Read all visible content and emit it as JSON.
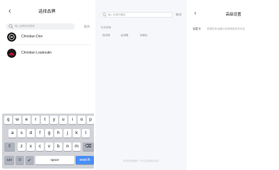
{
  "panel1": {
    "back_glyph": "‹",
    "title": "选择品牌",
    "search_placeholder": "输入品牌名称搜索",
    "cancel_label": "取消",
    "brands": [
      {
        "name": "Christian Dior",
        "logo": "dior-logo-icon",
        "color": "#1a1a1a"
      },
      {
        "name": "Christian Louboutin",
        "logo": "louboutin-logo-icon",
        "color": "#c8102e"
      }
    ]
  },
  "keyboard": {
    "row1": [
      "q",
      "w",
      "e",
      "r",
      "t",
      "y",
      "u",
      "i",
      "o",
      "p"
    ],
    "row2": [
      "a",
      "s",
      "d",
      "f",
      "g",
      "h",
      "j",
      "k",
      "l"
    ],
    "row3": [
      "z",
      "x",
      "c",
      "v",
      "b",
      "n",
      "m"
    ],
    "shift": "⇧",
    "delete": "⌫",
    "numbers": "123",
    "emoji": "☺",
    "mic": "🎤",
    "space": "space",
    "search": "search"
  },
  "panel2": {
    "search_placeholder": "输入关键词搜索",
    "cancel_label": "取消",
    "history_title": "历史搜索",
    "chips": [
      "连衣裙",
      "运动鞋",
      "双肩包"
    ],
    "footer_tip": "没有找到想要的？可以试试其他关键词"
  },
  "panel3": {
    "back_glyph": "‹",
    "title": "高级设置",
    "row_label": "自定义",
    "row_desc": "根据您的设置为您推荐更多的内容"
  },
  "colors": {
    "accent": "#4a8ef5",
    "keyboard_bg": "#d1d3d9",
    "panel2_bg": "#f6f7fa"
  }
}
